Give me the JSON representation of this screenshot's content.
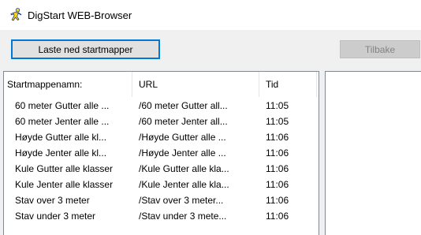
{
  "window": {
    "title": "DigStart WEB-Browser"
  },
  "toolbar": {
    "download_label": "Laste ned startmapper",
    "back_label": "Tilbake"
  },
  "table": {
    "headers": [
      "Startmappenamn:",
      "URL",
      "Tid"
    ],
    "rows": [
      {
        "name": "60 meter Gutter alle ...",
        "url": "/60 meter Gutter all...",
        "time": "11:05"
      },
      {
        "name": "60 meter Jenter alle ...",
        "url": "/60 meter Jenter all...",
        "time": "11:05"
      },
      {
        "name": "Høyde Gutter alle kl...",
        "url": "/Høyde Gutter alle ...",
        "time": "11:06"
      },
      {
        "name": "Høyde Jenter alle kl...",
        "url": "/Høyde Jenter alle ...",
        "time": "11:06"
      },
      {
        "name": "Kule Gutter alle klasser",
        "url": "/Kule Gutter alle kla...",
        "time": "11:06"
      },
      {
        "name": "Kule Jenter alle klasser",
        "url": "/Kule Jenter alle kla...",
        "time": "11:06"
      },
      {
        "name": "Stav over 3 meter",
        "url": "/Stav over 3 meter...",
        "time": "11:06"
      },
      {
        "name": "Stav under 3 meter",
        "url": "/Stav under 3 mete...",
        "time": "11:06"
      }
    ]
  },
  "icons": {
    "app": "running-person-icon"
  },
  "colors": {
    "focus_border": "#0078d7",
    "window_bg": "#f0f0f0",
    "icon_yellow": "#ffd800",
    "icon_blue": "#1e3c96"
  }
}
